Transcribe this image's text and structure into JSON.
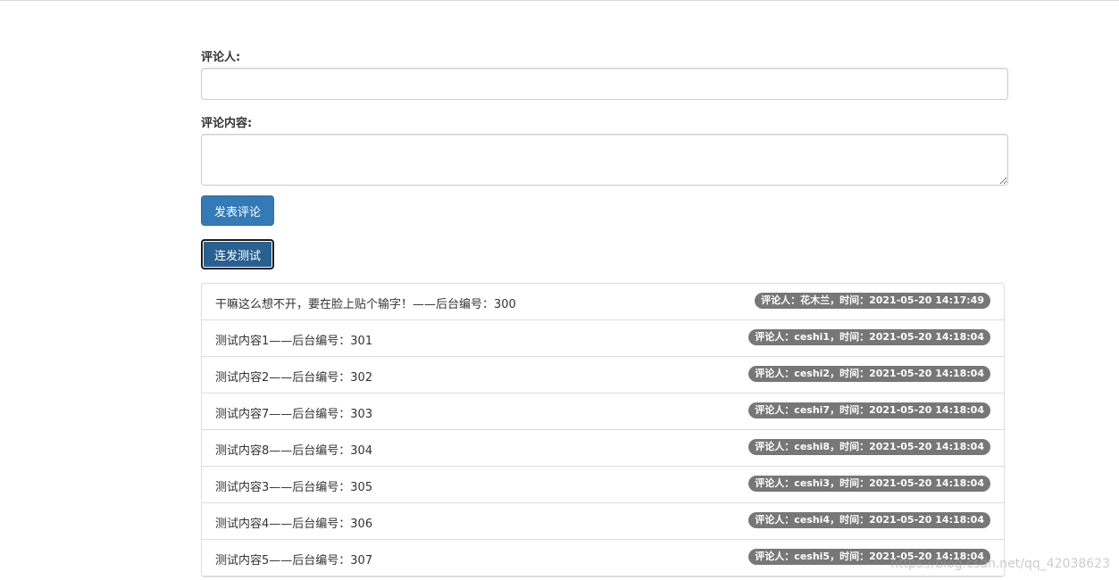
{
  "form": {
    "commenter_label": "评论人:",
    "commenter_value": "",
    "content_label": "评论内容:",
    "content_value": "",
    "submit_button": "发表评论",
    "burst_test_button": "连发测试"
  },
  "comments": [
    {
      "text": "干嘛这么想不开，要在脸上贴个输字！——后台编号：300",
      "meta": "评论人：花木兰，时间：2021-05-20 14:17:49"
    },
    {
      "text": "测试内容1——后台编号：301",
      "meta": "评论人：ceshi1，时间：2021-05-20 14:18:04"
    },
    {
      "text": "测试内容2——后台编号：302",
      "meta": "评论人：ceshi2，时间：2021-05-20 14:18:04"
    },
    {
      "text": "测试内容7——后台编号：303",
      "meta": "评论人：ceshi7，时间：2021-05-20 14:18:04"
    },
    {
      "text": "测试内容8——后台编号：304",
      "meta": "评论人：ceshi8，时间：2021-05-20 14:18:04"
    },
    {
      "text": "测试内容3——后台编号：305",
      "meta": "评论人：ceshi3，时间：2021-05-20 14:18:04"
    },
    {
      "text": "测试内容4——后台编号：306",
      "meta": "评论人：ceshi4，时间：2021-05-20 14:18:04"
    },
    {
      "text": "测试内容5——后台编号：307",
      "meta": "评论人：ceshi5，时间：2021-05-20 14:18:04"
    }
  ],
  "watermark": "https://blog.csdn.net/qq_42038623",
  "colors": {
    "primary": "#337ab7",
    "primary_active": "#286090",
    "badge": "#777777",
    "border": "#dddddd"
  }
}
